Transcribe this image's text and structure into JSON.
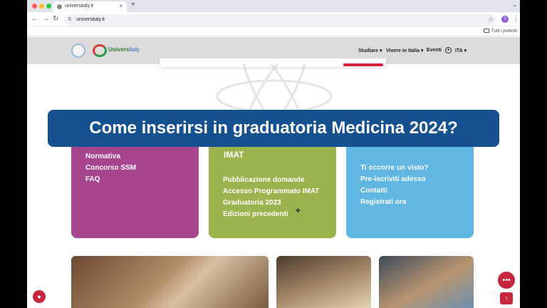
{
  "browser": {
    "tab_title": "universitaly.it",
    "tab_close": "×",
    "new_tab": "+",
    "url": "universitaly.it",
    "profile_initial": "S",
    "bookmarks_label": "Tutti i preferiti"
  },
  "header": {
    "brand_main": "Univers",
    "brand_accent": "Italy",
    "nav": [
      {
        "label": "Studiare ▾"
      },
      {
        "label": "Vivere in Italia ▾"
      },
      {
        "label": "Eventi"
      },
      {
        "label": "ITA ▾"
      }
    ]
  },
  "banner": {
    "title": "Come inserirsi in graduatoria Medicina 2024?"
  },
  "cards": {
    "purple": {
      "items": [
        "Normativa",
        "Concorso SSM",
        "FAQ"
      ]
    },
    "green": {
      "title": "IMAT",
      "items": [
        "Pubblicazione domande",
        "Accesso Programmato IMAT",
        "Graduatoria 2023",
        "Edizioni precedenti"
      ]
    },
    "blue": {
      "items": [
        "Ti occorre un visto?",
        "Pre-iscriviti adesso",
        "Contatti",
        "Registrati ora"
      ]
    }
  },
  "colors": {
    "banner": "#15508f",
    "purple": "#a8458f",
    "green": "#9bb34c",
    "blue": "#5fb6e2",
    "accent_red": "#c8253e"
  },
  "icons": {
    "cookie": "cookie-icon",
    "chat": "chat-icon",
    "back_to_top": "arrow-up-icon"
  }
}
